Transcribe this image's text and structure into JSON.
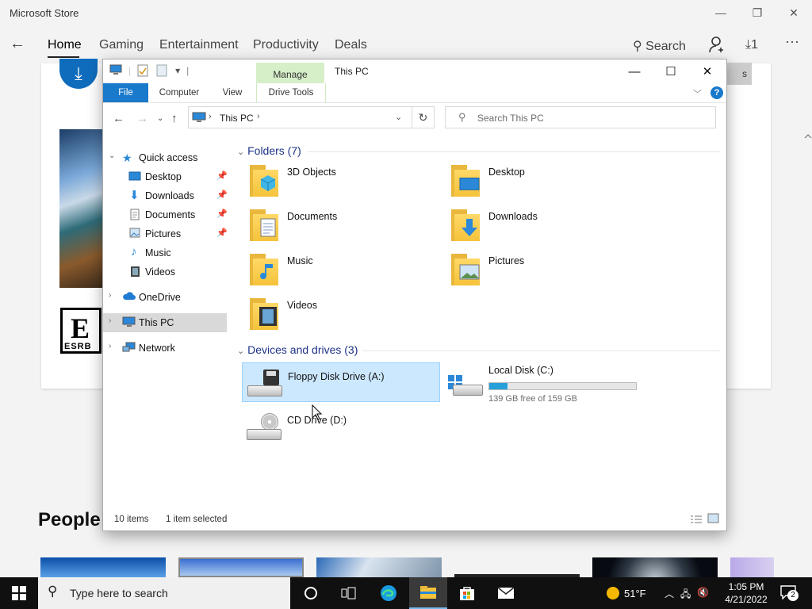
{
  "store": {
    "title": "Microsoft Store",
    "nav": [
      "Home",
      "Gaming",
      "Entertainment",
      "Productivity",
      "Deals"
    ],
    "search_label": "Search",
    "downloads_count": "1",
    "more_label": "···",
    "people_section": "People",
    "esrb_letter": "E",
    "esrb_text": "ESRB",
    "button_partial": "s"
  },
  "explorer": {
    "window_title": "This PC",
    "manage_tab": "Manage",
    "ribbon_tabs": [
      "File",
      "Computer",
      "View",
      "Drive Tools"
    ],
    "address": "This PC",
    "search_placeholder": "Search This PC",
    "nav_pane": {
      "quick_access": "Quick access",
      "quick_items": [
        "Desktop",
        "Downloads",
        "Documents",
        "Pictures",
        "Music",
        "Videos"
      ],
      "onedrive": "OneDrive",
      "this_pc": "This PC",
      "network": "Network"
    },
    "folders_header": "Folders (7)",
    "folders": [
      "3D Objects",
      "Desktop",
      "Documents",
      "Downloads",
      "Music",
      "Pictures",
      "Videos"
    ],
    "drives_header": "Devices and drives (3)",
    "drives": {
      "floppy": "Floppy Disk Drive (A:)",
      "local": "Local Disk (C:)",
      "local_free": "139 GB free of 159 GB",
      "local_used_fraction": 0.126,
      "cd": "CD Drive (D:)"
    },
    "status_items": "10 items",
    "status_selected": "1 item selected"
  },
  "taskbar": {
    "search_placeholder": "Type here to search",
    "weather": "51°F",
    "time": "1:05 PM",
    "date": "4/21/2022",
    "notifications": "2"
  },
  "colors": {
    "accent": "#1979ca",
    "selection": "#cce8ff",
    "manage_green": "#d6efc8",
    "header_blue": "#1e3287",
    "capacity_blue": "#26a0da"
  }
}
